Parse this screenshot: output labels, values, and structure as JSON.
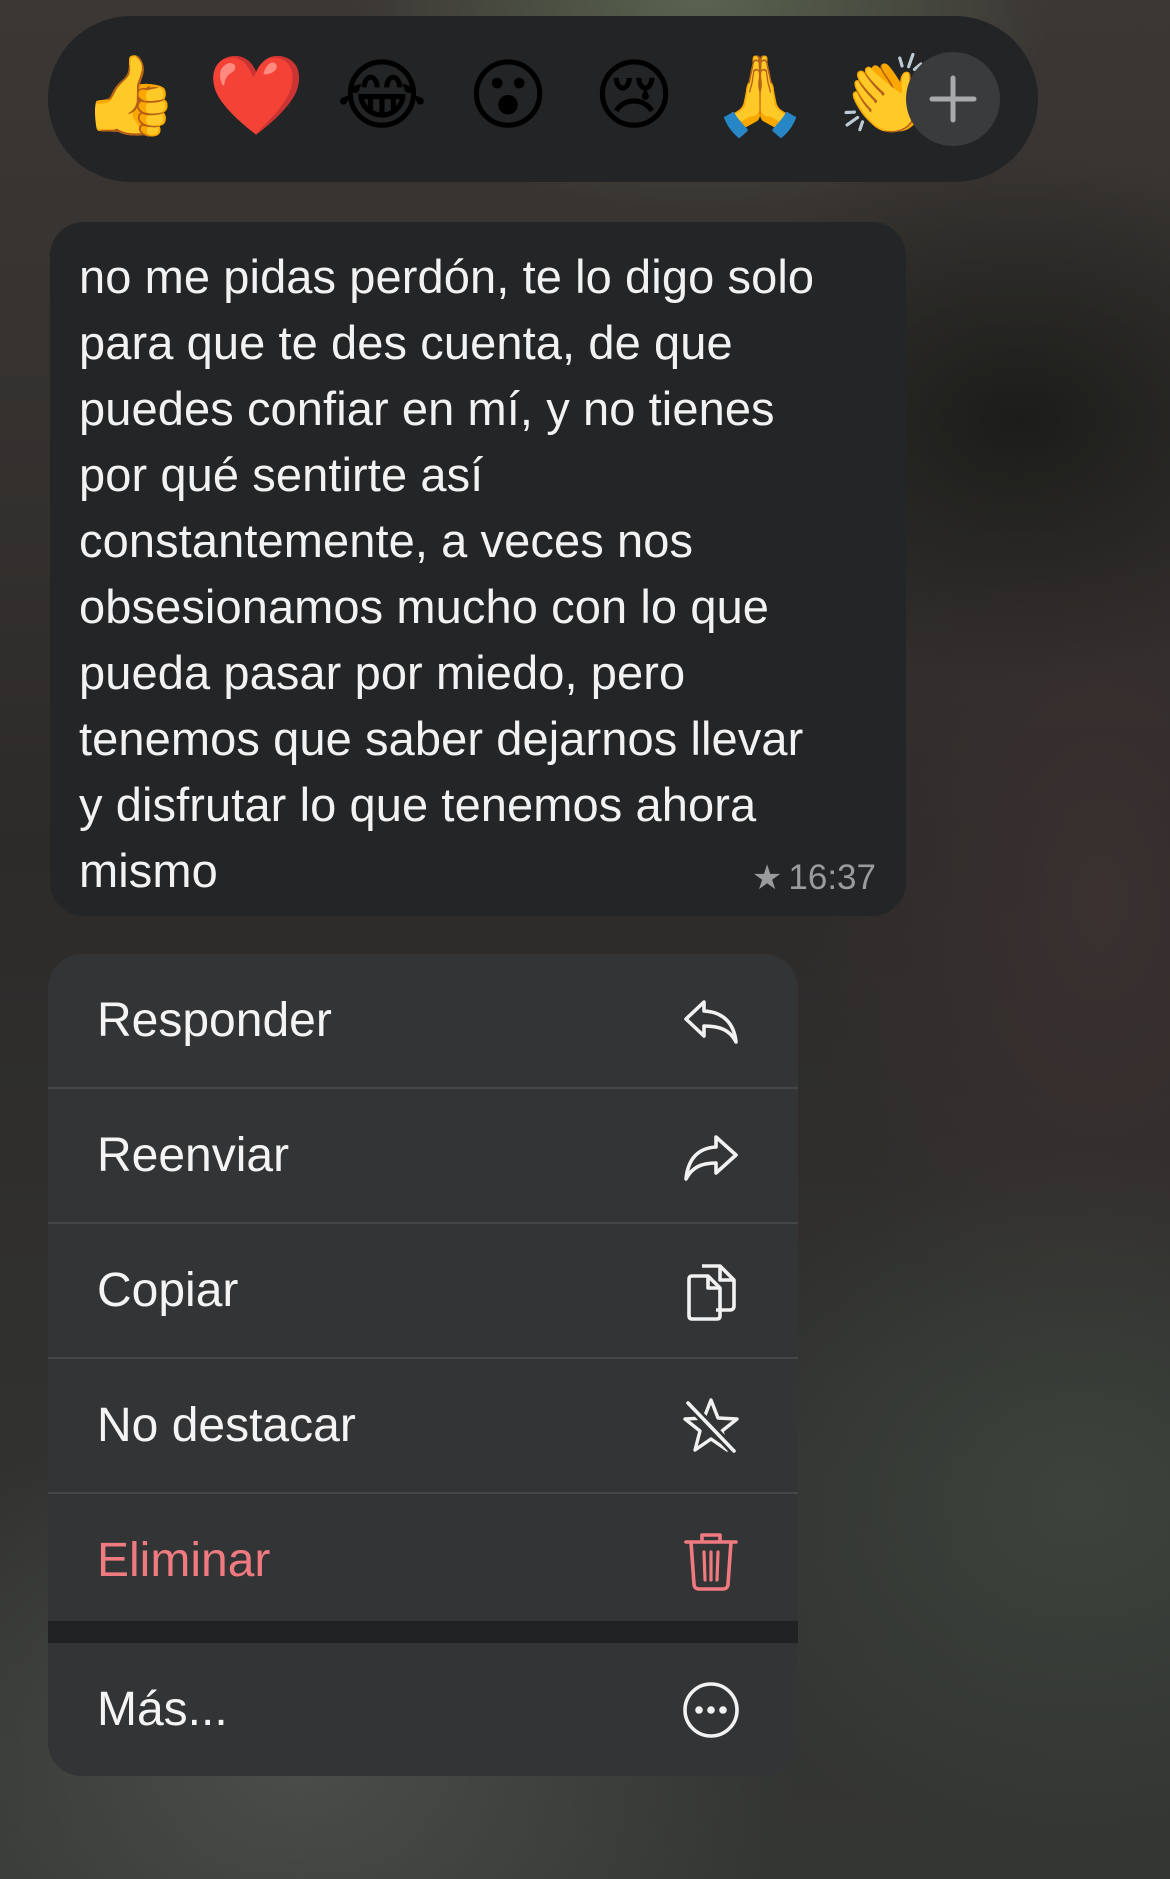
{
  "reactions": {
    "emojis": [
      {
        "name": "thumbs-up",
        "char": "👍"
      },
      {
        "name": "red-heart",
        "char": "❤️"
      },
      {
        "name": "tears-of-joy",
        "char": "😂"
      },
      {
        "name": "surprised-face",
        "char": "😮"
      },
      {
        "name": "crying-face",
        "char": "😢"
      },
      {
        "name": "folded-hands",
        "char": "🙏"
      },
      {
        "name": "clapping-hands",
        "char": "👏"
      }
    ],
    "more_icon": "plus-icon"
  },
  "message": {
    "text": "no me pidas perdón, te lo digo solo\npara que te des cuenta, de que\npuedes confiar en mí, y no tienes\npor qué sentirte así\nconstantemente, a veces nos\nobsesionamos mucho con lo que\npueda pasar por miedo, pero\ntenemos que saber dejarnos llevar\ny disfrutar lo que tenemos ahora\nmismo",
    "starred_icon": "star-icon",
    "time": "16:37"
  },
  "menu": {
    "reply": {
      "label": "Responder",
      "icon": "reply-arrow-icon"
    },
    "forward": {
      "label": "Reenviar",
      "icon": "forward-arrow-icon"
    },
    "copy": {
      "label": "Copiar",
      "icon": "copy-icon"
    },
    "unstar": {
      "label": "No destacar",
      "icon": "unstar-icon"
    },
    "delete": {
      "label": "Eliminar",
      "icon": "trash-icon",
      "color": "#ef7a80"
    },
    "more": {
      "label": "Más...",
      "icon": "ellipsis-circle-icon"
    }
  },
  "colors": {
    "bubble": "#242526",
    "menu_item": "#333435",
    "danger": "#ef7a80"
  }
}
